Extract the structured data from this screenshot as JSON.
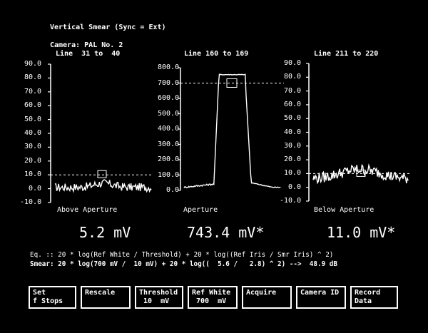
{
  "header": {
    "title": "Vertical Smear (Sync = Ext)",
    "camera": "Camera: PAL No. 2"
  },
  "panels": [
    {
      "line_label": "Line  31 to  40",
      "caption": "Above Aperture",
      "ticks": [
        "90.0",
        "80.0",
        "70.0",
        "60.0",
        "50.0",
        "40.0",
        "30.0",
        "20.0",
        "10.0",
        "0.0",
        "-10.0"
      ],
      "reading": "5.2 mV"
    },
    {
      "line_label": "Line 160 to 169",
      "caption": "Aperture",
      "ticks": [
        "800.0",
        "700.0",
        "600.0",
        "500.0",
        "400.0",
        "300.0",
        "200.0",
        "100.0",
        "0.0"
      ],
      "reading": "743.4 mV*"
    },
    {
      "line_label": "Line 211 to 220",
      "caption": "Below Aperture",
      "ticks": [
        "90.0",
        "80.0",
        "70.0",
        "60.0",
        "50.0",
        "40.0",
        "30.0",
        "20.0",
        "10.0",
        "0.0",
        "-10.0"
      ],
      "reading": "11.0 mV*"
    }
  ],
  "equations": {
    "eq": "Eq. :: 20 * log(Ref White / Threshold) + 20 * log((Ref Iris / Smr Iris) ^ 2)",
    "smear": "Smear: 20 * log(700 mV /  10 mV) + 20 * log((  5.6 /   2.8) ^ 2) -->  48.9 dB"
  },
  "buttons": [
    {
      "line1": "Set",
      "line2": "f Stops"
    },
    {
      "line1": "Rescale",
      "line2": ""
    },
    {
      "line1": "Threshold",
      "line2": " 10  mV"
    },
    {
      "line1": "Ref White",
      "line2": " 700  mV"
    },
    {
      "line1": "Acquire",
      "line2": ""
    },
    {
      "line1": "Camera ID",
      "line2": ""
    },
    {
      "line1": "Record",
      "line2": "Data"
    }
  ],
  "colors": {
    "background": "#000000",
    "foreground": "#ffffff"
  }
}
